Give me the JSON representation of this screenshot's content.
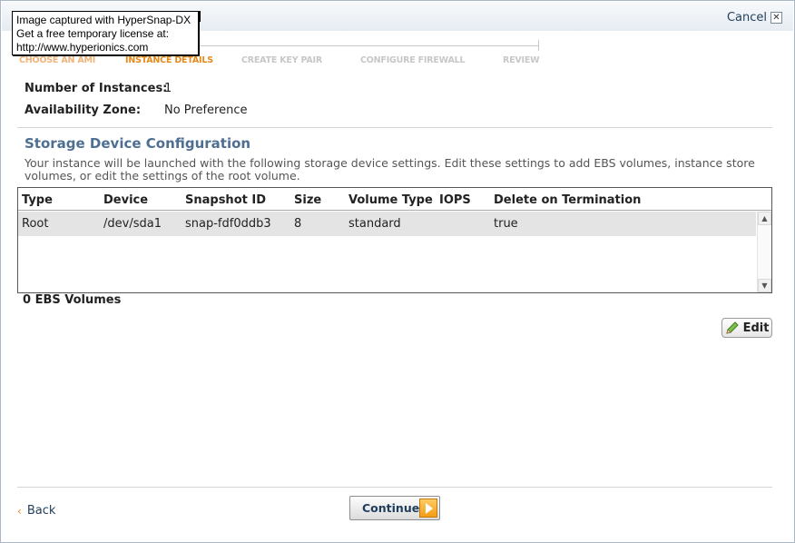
{
  "window": {
    "cancel_label": "Cancel"
  },
  "watermark": {
    "line1": "Image captured with HyperSnap-DX",
    "line2": "Get a free temporary license at:",
    "line3": "http://www.hyperionics.com"
  },
  "steps": [
    {
      "label": "CHOOSE AN AMI"
    },
    {
      "label": "INSTANCE DETAILS"
    },
    {
      "label": "CREATE KEY PAIR"
    },
    {
      "label": "CONFIGURE FIREWALL"
    },
    {
      "label": "REVIEW"
    }
  ],
  "fields": {
    "instances_label": "Number of Instances:",
    "instances_value": "1",
    "zone_label": "Availability Zone:",
    "zone_value": "No Preference"
  },
  "storage": {
    "title": "Storage Device Configuration",
    "description": "Your instance will be launched with the following storage device settings. Edit these settings to add EBS volumes, instance store volumes, or edit the settings of the root volume.",
    "columns": [
      "Type",
      "Device",
      "Snapshot ID",
      "Size",
      "Volume Type",
      "IOPS",
      "Delete on Termination"
    ],
    "rows": [
      {
        "type": "Root",
        "device": "/dev/sda1",
        "snapshot": "snap-fdf0ddb3",
        "size": "8",
        "volume_type": "standard",
        "iops": "",
        "delete": "true"
      }
    ],
    "ebs_count": "0 EBS Volumes",
    "edit_label": "Edit"
  },
  "footer": {
    "back_label": "Back",
    "continue_label": "Continue"
  },
  "colors": {
    "step_active": "#e88a1a",
    "step_done": "#f2b47a",
    "step_pending": "#c7c7c7",
    "section_title": "#4f6f92",
    "row_selected": "#e4e4e4"
  }
}
